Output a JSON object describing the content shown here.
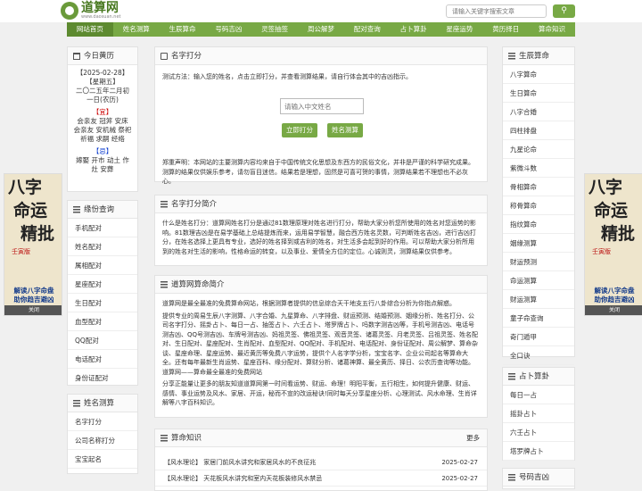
{
  "site": {
    "name": "道算网",
    "domain": "www.daosuan.net"
  },
  "search": {
    "placeholder": "请输入关键字搜索文章",
    "button_icon": "search-icon"
  },
  "nav": [
    "网站首页",
    "姓名测算",
    "生辰算命",
    "号码吉凶",
    "灵签抽签",
    "周公解梦",
    "配对查询",
    "占卜算卦",
    "星座运势",
    "黄历择日",
    "算命知识"
  ],
  "almanac": {
    "title": "今日黄历",
    "date": "【2025-02-28】",
    "weekday": "【星期五】",
    "lunar": "二〇二五年二月初一日(农历)",
    "yi_label": "【宜】",
    "yi": "会亲友 冠笄 安床 会亲友 安机械 祭祀 祈福 求嗣 经络",
    "ji_label": "【忌】",
    "ji": "嫁娶 开市 动土 作灶 安葬"
  },
  "marriage": {
    "title": "缘份查询",
    "items": [
      "手机配对",
      "姓名配对",
      "属相配对",
      "星座配对",
      "生日配对",
      "血型配对",
      "QQ配对",
      "电话配对",
      "身份证配对"
    ]
  },
  "naming": {
    "title": "姓名测算",
    "items": [
      "名字打分",
      "公司名称打分",
      "宝宝起名"
    ]
  },
  "score": {
    "title": "名字打分",
    "instruction": "测试方法：输入您的姓名，点击立即打分，并查看测算结果，请自行体会其中的吉凶指示。",
    "input_placeholder": "请输入中文姓名",
    "btn_score": "立即打分",
    "btn_match": "姓名测算",
    "disclaimer": "郑重声明：本网站的主要测算内容均来自于中国传统文化思想及东西方的民俗文化，并非是严谨的科学研究成果。测算的结果仅供娱乐参考，请勿盲目迷信。结果若是理想，固然是可喜可贺的事情，测算结果若不理想也不必灰心。"
  },
  "intro": {
    "title": "名字打分简介",
    "text": "什么是姓名打分：道算网姓名打分是通过81数理原理对姓名进行打分，帮助大家分析您所使用的姓名对您运势的影响。81数理吉凶是在易学基础上总结提炼而来，运用易学智慧，融合西方姓名灵数，可判断姓名吉凶，进行吉凶打分，在姓名选择上更具有专业，选好的姓名择到或吉利的姓名，对生活多会起到好的作用。可以帮助大家分析所用到的姓名对生活的影响，性格命运的转变，以及事业、爱情全方位的定位。心诚则灵，测算结果仅供参考。"
  },
  "about": {
    "title": "道算网算命简介",
    "p1": "道算网是最全最准的免费算命网站，根据测算者提供的信息综合天干地支五行八卦综合分析为你指点解惑。",
    "p2": "提供专业的周易生辰八字测算、八字合婚、九星算命、八字排盘、财运预测、结婚预测、姻缘分析、姓名打分、公司名字打分、摇卦占卜、每日一占、抽签占卜、六壬占卜、塔罗牌占卜、吗数字测吉凶等，手机号测吉凶、电话号测吉凶、QQ号测吉凶、车牌号测吉凶、妈祖灵签、佛祖灵签、观音灵签、诸葛灵签、月老灵签、吕祖灵签、姓名配对、生日配对、星座配对、生肖配对、血型配对、QQ配对、手机配对、电话配对、身份证配对、周公解梦、算命杂谈、星座命理、星座运势、最近黄历等免费八字运势，提供个人名字学分析，宝宝名字、企业公司起名等算命大全。还有每年最新生肖运势、星座百科、缘分配对、算财分析、诸葛神算、最全黄历、择日、公农历查询等功能。道算网——算命最全最准的免费网站",
    "p3": "分享正能量让更多的朋友知道道算网第一时间看运势、财运、命理！明阳平衡，五行相生，如何提升健康、财运、感情、事业运势及风水、家居、开运，秘而不宣的改运秘诀!同时每天分享星座分析、心理测试、风水命理、生肖详解等八字百科知识。"
  },
  "knowledge": {
    "title": "算命知识",
    "more": "更多",
    "items": [
      {
        "tag": "【风水理论】",
        "title": "家居门前风水讲究和家居风水的不良征兆",
        "date": "2025-02-27"
      },
      {
        "tag": "【风水理论】",
        "title": "天花板风水讲究和室内天花板装修风水禁忌",
        "date": "2025-02-27"
      }
    ]
  },
  "birth": {
    "title": "生辰算命",
    "items": [
      "八字算命",
      "生日算命",
      "八字合婚",
      "四柱排盘",
      "九星论命",
      "紫微斗数",
      "骨相算命",
      "称骨算命",
      "指纹算命",
      "姻缘测算",
      "财运预测",
      "命运测算",
      "财运测算",
      "童子命查询",
      "奇门遁甲",
      "全口诀"
    ]
  },
  "divination": {
    "title": "占卜算卦",
    "items": [
      "每日一占",
      "摇卦占卜",
      "六壬占卜",
      "塔罗牌占卜"
    ]
  },
  "number": {
    "title": "号码吉凶"
  },
  "ad": {
    "big1": "八字",
    "big2": "命运",
    "big3": "精批",
    "tag": "壬寅版",
    "line1": "解读八字命盘",
    "line2": "助你趋吉避凶",
    "close": "关闭"
  }
}
